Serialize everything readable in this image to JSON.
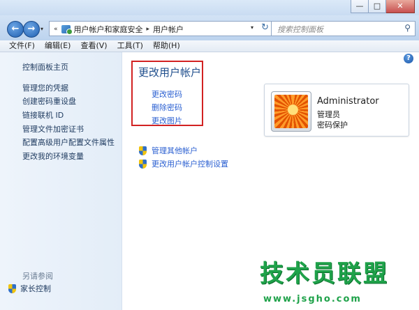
{
  "window": {
    "controls": {
      "minimize": "—",
      "maximize": "□",
      "close": "✕"
    }
  },
  "nav": {
    "back_icon": "←",
    "forward_icon": "→",
    "dropdown_icon": "▾"
  },
  "address": {
    "overflow": "«",
    "separator": "▸",
    "crumbs": [
      "用户帐户和家庭安全",
      "用户帐户"
    ],
    "dropdown": "▾",
    "refresh": "↻"
  },
  "search": {
    "placeholder": "搜索控制面板",
    "icon": "⚲"
  },
  "menu": [
    "文件(F)",
    "编辑(E)",
    "查看(V)",
    "工具(T)",
    "帮助(H)"
  ],
  "help_icon": "?",
  "sidebar": {
    "items": [
      "控制面板主页",
      "管理您的凭据",
      "创建密码重设盘",
      "链接联机 ID",
      "管理文件加密证书",
      "配置高级用户配置文件属性",
      "更改我的环境变量"
    ],
    "see_also": "另请参阅",
    "family": "家长控制"
  },
  "main": {
    "title": "更改用户帐户",
    "links": [
      "更改密码",
      "删除密码",
      "更改图片"
    ],
    "shield_links": [
      "管理其他帐户",
      "更改用户帐户控制设置"
    ]
  },
  "user": {
    "name": "Administrator",
    "role": "管理员",
    "status": "密码保护"
  },
  "colors": {
    "accent": "#1f4e8c",
    "link": "#2a5fd1",
    "highlight": "#d22222",
    "watermark": "#1fa24a"
  },
  "watermark": {
    "main": "技术员联盟",
    "sub": "www.jsgho.com"
  }
}
